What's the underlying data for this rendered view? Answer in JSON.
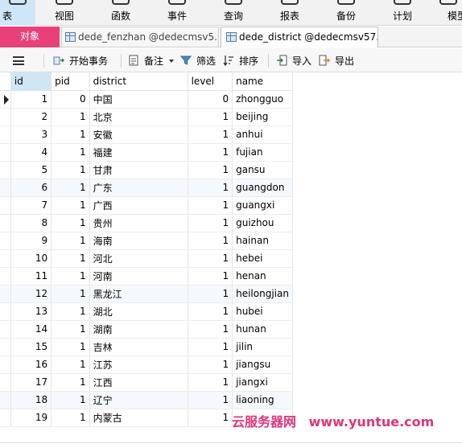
{
  "ribbon": {
    "items": [
      {
        "label": "表",
        "icon": "table-icon"
      },
      {
        "label": "视图",
        "icon": "view-icon"
      },
      {
        "label": "函数",
        "icon": "function-icon"
      },
      {
        "label": "事件",
        "icon": "event-icon"
      },
      {
        "label": "查询",
        "icon": "query-icon"
      },
      {
        "label": "报表",
        "icon": "report-icon"
      },
      {
        "label": "备份",
        "icon": "backup-icon"
      },
      {
        "label": "计划",
        "icon": "schedule-icon"
      },
      {
        "label": "模型",
        "icon": "model-icon"
      }
    ]
  },
  "tabs": {
    "objects_label": "对象",
    "tab1": "dede_fenzhan @dedecmsv5...",
    "tab2": "dede_district @dedecmsv57..."
  },
  "toolbar": {
    "begin_transaction": "开始事务",
    "note": "备注",
    "filter": "筛选",
    "sort": "排序",
    "import": "导入",
    "export": "导出"
  },
  "grid": {
    "columns": [
      "id",
      "pid",
      "district",
      "level",
      "name"
    ],
    "rows": [
      {
        "id": "1",
        "pid": "0",
        "district": "中国",
        "level": "0",
        "name": "zhongguo"
      },
      {
        "id": "2",
        "pid": "1",
        "district": "北京",
        "level": "1",
        "name": "beijing"
      },
      {
        "id": "3",
        "pid": "1",
        "district": "安徽",
        "level": "1",
        "name": "anhui"
      },
      {
        "id": "4",
        "pid": "1",
        "district": "福建",
        "level": "1",
        "name": "fujian"
      },
      {
        "id": "5",
        "pid": "1",
        "district": "甘肃",
        "level": "1",
        "name": "gansu"
      },
      {
        "id": "6",
        "pid": "1",
        "district": "广东",
        "level": "1",
        "name": "guangdon"
      },
      {
        "id": "7",
        "pid": "1",
        "district": "广西",
        "level": "1",
        "name": "guangxi"
      },
      {
        "id": "8",
        "pid": "1",
        "district": "贵州",
        "level": "1",
        "name": "guizhou"
      },
      {
        "id": "9",
        "pid": "1",
        "district": "海南",
        "level": "1",
        "name": "hainan"
      },
      {
        "id": "10",
        "pid": "1",
        "district": "河北",
        "level": "1",
        "name": "hebei"
      },
      {
        "id": "11",
        "pid": "1",
        "district": "河南",
        "level": "1",
        "name": "henan"
      },
      {
        "id": "12",
        "pid": "1",
        "district": "黑龙江",
        "level": "1",
        "name": "heilongjian"
      },
      {
        "id": "13",
        "pid": "1",
        "district": "湖北",
        "level": "1",
        "name": "hubei"
      },
      {
        "id": "14",
        "pid": "1",
        "district": "湖南",
        "level": "1",
        "name": "hunan"
      },
      {
        "id": "15",
        "pid": "1",
        "district": "吉林",
        "level": "1",
        "name": "jilin"
      },
      {
        "id": "16",
        "pid": "1",
        "district": "江苏",
        "level": "1",
        "name": "jiangsu"
      },
      {
        "id": "17",
        "pid": "1",
        "district": "江西",
        "level": "1",
        "name": "jiangxi"
      },
      {
        "id": "18",
        "pid": "1",
        "district": "辽宁",
        "level": "1",
        "name": "liaoning"
      },
      {
        "id": "19",
        "pid": "1",
        "district": "内蒙古",
        "level": "1",
        "name": ""
      }
    ]
  },
  "watermark": {
    "cn": "云服务器网",
    "url": "www.yuntue.com"
  },
  "colors": {
    "accent": "#e8417a",
    "selection": "#cfe6f7",
    "watermark": "#e0347a"
  }
}
